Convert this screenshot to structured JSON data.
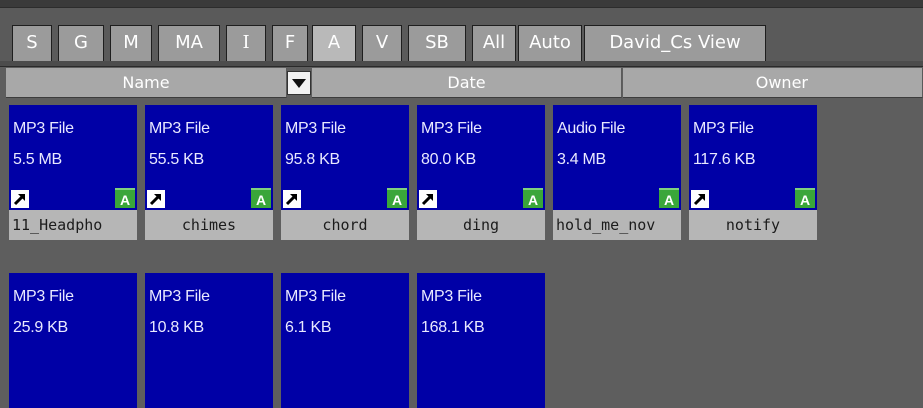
{
  "tabs": [
    {
      "label": "S",
      "active": false
    },
    {
      "label": "G",
      "active": false
    },
    {
      "label": "M",
      "active": false
    },
    {
      "label": "MA",
      "active": false
    },
    {
      "label": "I",
      "active": false
    },
    {
      "label": "F",
      "active": false
    },
    {
      "label": "A",
      "active": true
    },
    {
      "label": "V",
      "active": false
    },
    {
      "label": "SB",
      "active": false
    },
    {
      "label": "All",
      "active": false
    },
    {
      "label": "Auto",
      "active": false
    },
    {
      "label": "David_Cs View",
      "active": false
    }
  ],
  "columns": {
    "name": "Name",
    "date": "Date",
    "owner": "Owner"
  },
  "files": [
    {
      "type": "MP3 File",
      "size": "5.5 MB",
      "name": "11_Headpho",
      "shortcut": true,
      "badge": "A"
    },
    {
      "type": "MP3 File",
      "size": "55.5 KB",
      "name": "chimes",
      "shortcut": true,
      "badge": "A"
    },
    {
      "type": "MP3 File",
      "size": "95.8 KB",
      "name": "chord",
      "shortcut": true,
      "badge": "A"
    },
    {
      "type": "MP3 File",
      "size": "80.0 KB",
      "name": "ding",
      "shortcut": true,
      "badge": "A"
    },
    {
      "type": "Audio File",
      "size": "3.4 MB",
      "name": "hold_me_nov",
      "shortcut": false,
      "badge": "A"
    },
    {
      "type": "MP3 File",
      "size": "117.6 KB",
      "name": "notify",
      "shortcut": true,
      "badge": "A"
    },
    {
      "type": "MP3 File",
      "size": "25.9 KB"
    },
    {
      "type": "MP3 File",
      "size": "10.8 KB"
    },
    {
      "type": "MP3 File",
      "size": "6.1 KB"
    },
    {
      "type": "MP3 File",
      "size": "168.1 KB"
    }
  ],
  "colors": {
    "tile_bg": "#0000a6",
    "tab_bg": "#9b9b9b",
    "active_tab_bg": "#b9b9b9",
    "badge_green": "#3aa63a"
  }
}
